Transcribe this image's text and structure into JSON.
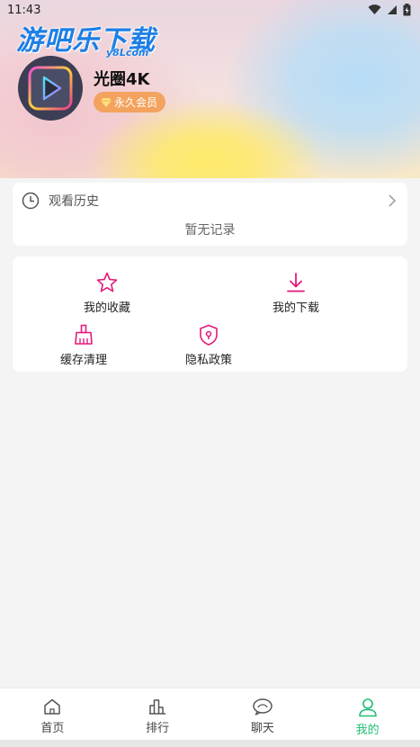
{
  "status_bar": {
    "time": "11:43"
  },
  "watermark": {
    "main": "游吧乐下载",
    "sub": "y8Lcom"
  },
  "profile": {
    "username": "光圈4K",
    "vip_label": "永久会员"
  },
  "history": {
    "title": "观看历史",
    "empty_text": "暂无记录"
  },
  "menu": {
    "favorites": "我的收藏",
    "downloads": "我的下载",
    "clear_cache": "缓存清理",
    "privacy": "隐私政策"
  },
  "tabbar": {
    "home": "首页",
    "ranking": "排行",
    "chat": "聊天",
    "mine": "我的"
  },
  "colors": {
    "accent": "#e6197a",
    "active_tab": "#1dbf73",
    "vip_badge": "#f3a35e"
  }
}
